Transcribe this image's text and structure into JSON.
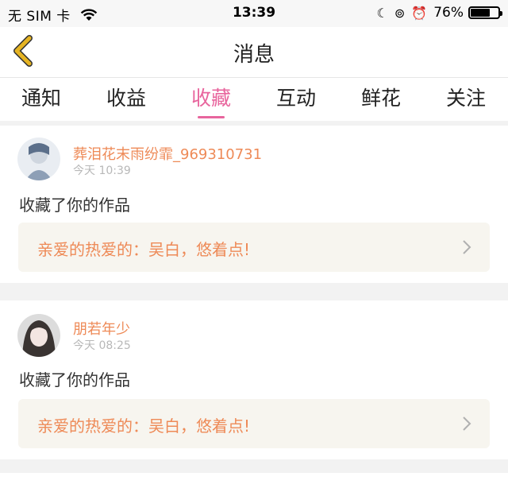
{
  "status_bar": {
    "carrier": "无 SIM 卡",
    "time": "13:39",
    "battery_percent": "76%",
    "battery_level": 0.76
  },
  "nav": {
    "title": "消息"
  },
  "tabs": [
    {
      "label": "通知"
    },
    {
      "label": "收益"
    },
    {
      "label": "收藏",
      "active": true
    },
    {
      "label": "互动"
    },
    {
      "label": "鲜花"
    },
    {
      "label": "关注"
    }
  ],
  "messages": [
    {
      "name": "葬泪花末雨纷霏_969310731",
      "time": "今天 10:39",
      "text": "收藏了你的作品",
      "quote": "亲爱的热爱的：吴白，悠着点!"
    },
    {
      "name": "朋若年少",
      "time": "今天 08:25",
      "text": "收藏了你的作品",
      "quote": "亲爱的热爱的：吴白，悠着点!"
    }
  ],
  "colors": {
    "accent": "#e8659d",
    "name": "#ee8a57",
    "back_arrow": "#e6b422"
  }
}
